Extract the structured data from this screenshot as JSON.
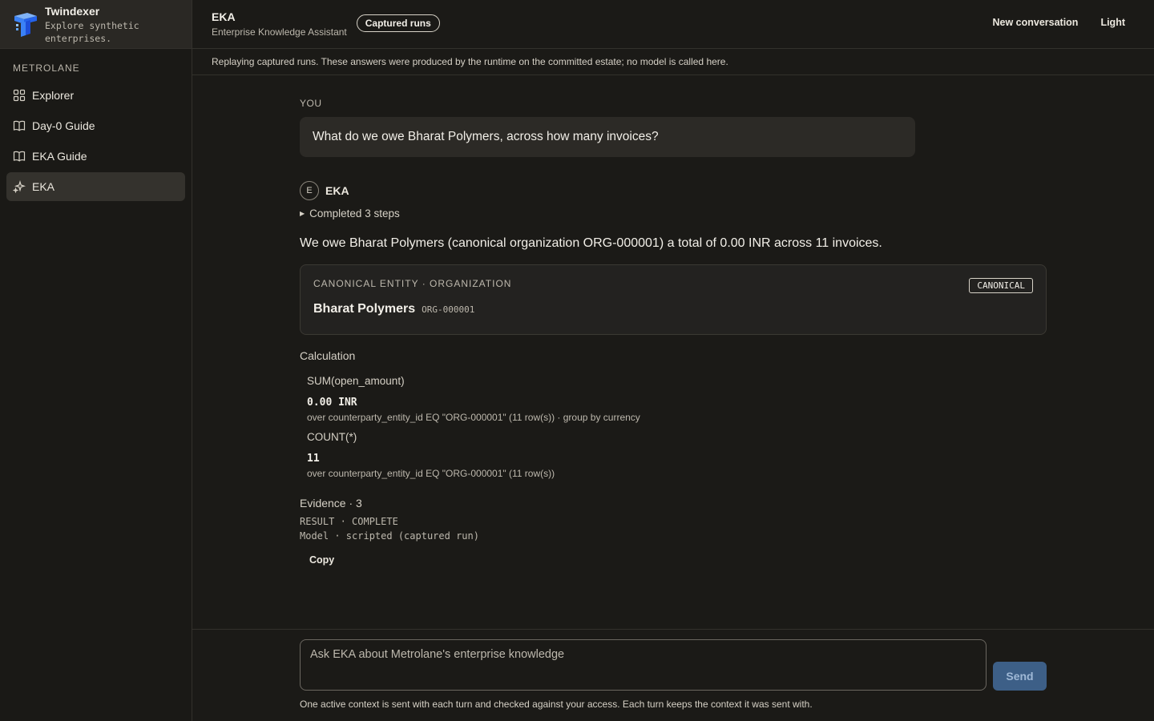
{
  "brand": {
    "name": "Twindexer",
    "tagline": "Explore synthetic enterprises."
  },
  "sidebar": {
    "section_label": "METROLANE",
    "items": [
      {
        "label": "Explorer",
        "icon": "grid-icon",
        "active": false
      },
      {
        "label": "Day-0 Guide",
        "icon": "book-icon",
        "active": false
      },
      {
        "label": "EKA Guide",
        "icon": "book-icon",
        "active": false
      },
      {
        "label": "EKA",
        "icon": "sparkle-icon",
        "active": true
      }
    ]
  },
  "header": {
    "title": "EKA",
    "subtitle": "Enterprise Knowledge Assistant",
    "badge": "Captured runs",
    "new_conversation": "New conversation",
    "theme_toggle": "Light"
  },
  "notice": "Replaying captured runs. These answers were produced by the runtime on the committed estate; no model is called here.",
  "conversation": {
    "you_label": "YOU",
    "question": "What do we owe Bharat Polymers, across how many invoices?",
    "assistant_initial": "E",
    "assistant_name": "EKA",
    "steps": "Completed 3 steps",
    "answer": "We owe Bharat Polymers (canonical organization ORG-000001) a total of 0.00 INR across 11 invoices.",
    "entity": {
      "kind": "CANONICAL ENTITY · ORGANIZATION",
      "badge": "CANONICAL",
      "name": "Bharat Polymers",
      "id": "ORG-000001"
    },
    "calculation_label": "Calculation",
    "calculations": [
      {
        "expr": "SUM(open_amount)",
        "value": "0.00 INR",
        "detail": "over counterparty_entity_id EQ \"ORG-000001\" (11 row(s)) · group by currency"
      },
      {
        "expr": "COUNT(*)",
        "value": "11",
        "detail": "over counterparty_entity_id EQ \"ORG-000001\" (11 row(s))"
      }
    ],
    "evidence_label": "Evidence · 3",
    "result_line": "RESULT · COMPLETE",
    "model_line": "Model · scripted (captured run)",
    "copy": "Copy"
  },
  "composer": {
    "placeholder": "Ask EKA about Metrolane's enterprise knowledge",
    "send": "Send",
    "note": "One active context is sent with each turn and checked against your access. Each turn keeps the context it was sent with."
  },
  "colors": {
    "background": "#1b1a17",
    "sidebar_active": "#34322d",
    "send_button": "#3d5f87",
    "logo_blue": "#3b82f6"
  }
}
